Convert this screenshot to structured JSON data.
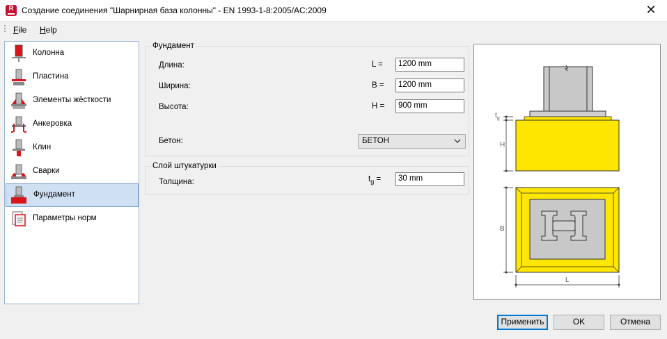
{
  "window": {
    "title": "Создание соединения \"Шарнирная база колонны\" - EN 1993-1-8:2005/AC:2009",
    "icon_letter": "R",
    "close_glyph": "✕"
  },
  "menu": {
    "file_key": "F",
    "file_rest": "ile",
    "help_key": "H",
    "help_rest": "elp"
  },
  "nav": {
    "items": [
      {
        "label": "Колонна",
        "icon": "column-icon"
      },
      {
        "label": "Пластина",
        "icon": "plate-icon"
      },
      {
        "label": "Элементы жёсткости",
        "icon": "stiffeners-icon"
      },
      {
        "label": "Анкеровка",
        "icon": "anchorage-icon"
      },
      {
        "label": "Клин",
        "icon": "shear-key-icon"
      },
      {
        "label": "Сварки",
        "icon": "welds-icon"
      },
      {
        "label": "Фундамент",
        "icon": "foundation-icon",
        "active": true
      },
      {
        "label": "Параметры норм",
        "icon": "code-params-icon"
      }
    ]
  },
  "foundation": {
    "title": "Фундамент",
    "length_label": "Длина:",
    "length_sym": "L =",
    "length_value": "1200 mm",
    "width_label": "Ширина:",
    "width_sym": "B =",
    "width_value": "1200 mm",
    "height_label": "Высота:",
    "height_sym": "H =",
    "height_value": "900 mm",
    "concrete_label": "Бетон:",
    "concrete_value": "БЕТОН"
  },
  "grout": {
    "title": "Слой штукатурки",
    "thickness_label": "Толщина:",
    "sym_main": "t",
    "sym_sub": "g",
    "sym_eq": " =",
    "thickness_value": "30 mm"
  },
  "preview": {
    "tg_main": "t",
    "tg_sub": "g",
    "h_label": "H",
    "b_label": "B",
    "l_label": "L",
    "colors": {
      "concrete": "#ffe600",
      "concrete_border": "#c8a400",
      "steel": "#c8c8c8",
      "steel_dark": "#5a5a5a"
    }
  },
  "buttons": {
    "apply": "Применить",
    "ok": "OK",
    "cancel": "Отмена"
  }
}
